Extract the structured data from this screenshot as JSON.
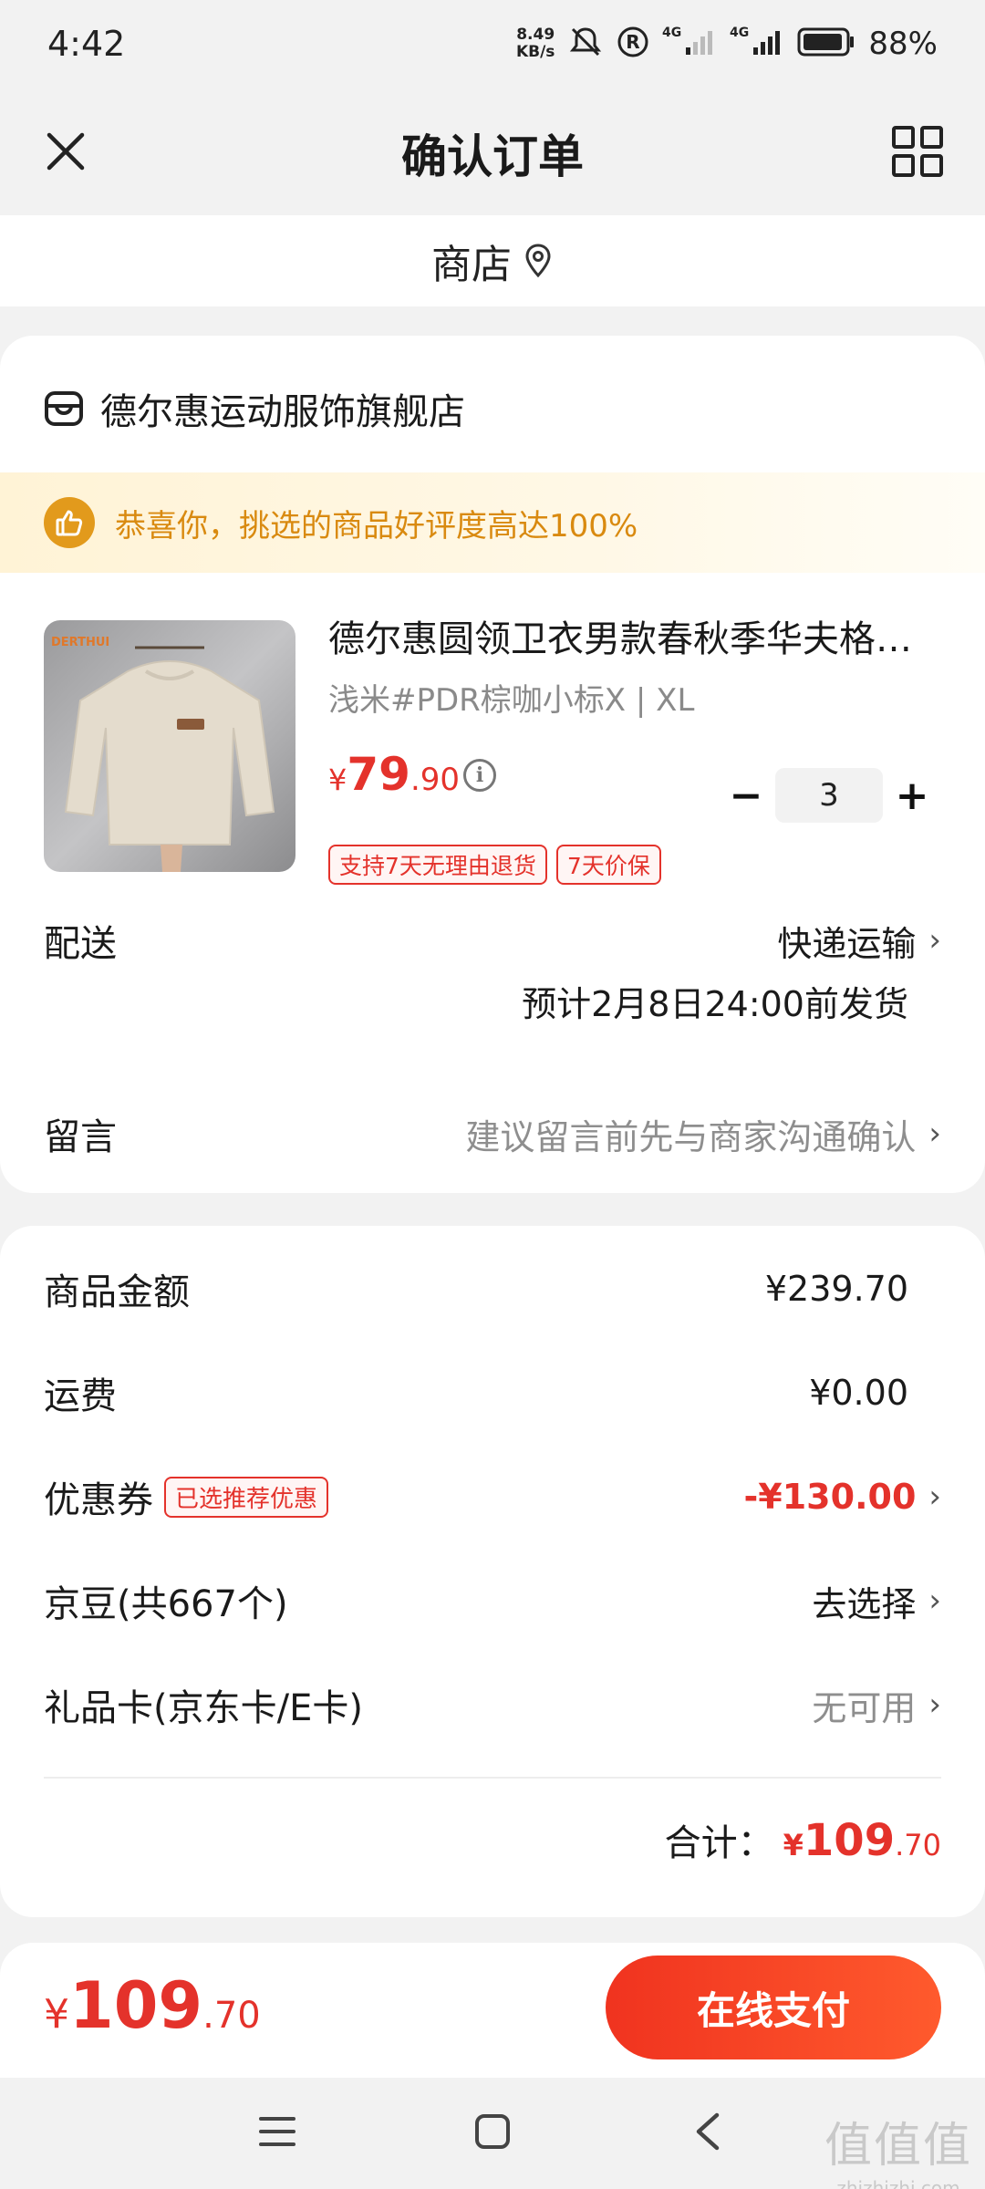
{
  "status_bar": {
    "time": "4:42",
    "speed": "8.49",
    "speed_unit": "KB/s",
    "network_1": "4G",
    "network_2": "4G",
    "battery": "88%"
  },
  "header": {
    "title": "确认订单",
    "close_icon": "close-icon",
    "menu_icon": "grid-icon"
  },
  "shop_bar": {
    "label": "商店",
    "icon": "location-pin-icon"
  },
  "order": {
    "store_name": "德尔惠运动服饰旗舰店",
    "praise_text": "恭喜你，挑选的商品好评度高达100%",
    "product": {
      "title": "德尔惠圆领卫衣男款春秋季华夫格…",
      "spec": "浅米#PDR棕咖小标X | XL",
      "price_yen": "¥",
      "price_int": "79",
      "price_dec": ".90",
      "quantity": "3",
      "minus": "−",
      "plus": "+",
      "tags": [
        "支持7天无理由退货",
        "7天价保"
      ]
    },
    "delivery": {
      "label": "配送",
      "value": "快递运输",
      "estimate": "预计2月8日24:00前发货"
    },
    "message": {
      "label": "留言",
      "placeholder": "建议留言前先与商家沟通确认"
    }
  },
  "summary": {
    "goods_label": "商品金额",
    "goods_value": "¥239.70",
    "shipping_label": "运费",
    "shipping_value": "¥0.00",
    "coupon_label": "优惠券",
    "coupon_tag": "已选推荐优惠",
    "coupon_value": "-¥130.00",
    "jingdou_label": "京豆(共667个)",
    "jingdou_value": "去选择",
    "giftcard_label": "礼品卡(京东卡/E卡)",
    "giftcard_value": "无可用",
    "total_label": "合计：",
    "total_yen": "¥",
    "total_int": "109",
    "total_dec": ".70"
  },
  "paybar": {
    "yen": "¥",
    "amount_int": "109",
    "amount_dec": ".70",
    "pay_button": "在线支付"
  },
  "watermark": {
    "glyphs": "值值值",
    "url": "zhizhizhi.com"
  },
  "colors": {
    "accent_red": "#e4322b",
    "praise_orange": "#d98a10",
    "pay_button_start": "#f0331f",
    "pay_button_end": "#ff5a2d"
  }
}
